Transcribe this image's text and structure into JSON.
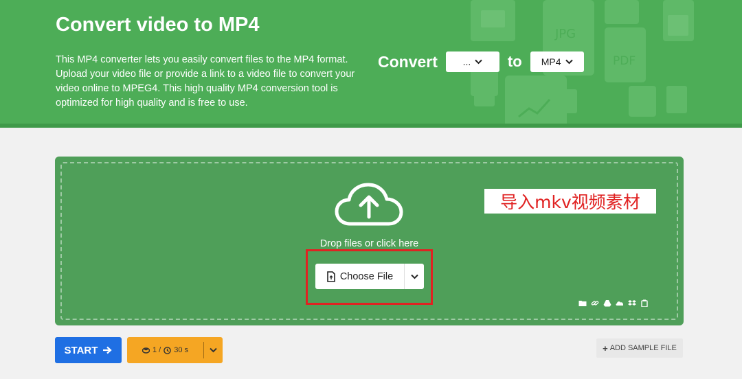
{
  "header": {
    "title": "Convert video to MP4",
    "description": "This MP4 converter lets you easily convert files to the MP4 format. Upload your video file or provide a link to a video file to convert your video online to MPEG4. This high quality MP4 conversion tool is optimized for high quality and is free to use.",
    "decor_labels": {
      "jpg": "JPG",
      "pdf": "PDF"
    }
  },
  "converter": {
    "convert_label": "Convert",
    "from_value": "...",
    "to_label": "to",
    "to_value": "MP4"
  },
  "dropzone": {
    "drop_text": "Drop files or click here",
    "choose_file_label": "Choose File",
    "annotation": "导入mkv视频素材",
    "source_icons": [
      "folder-icon",
      "link-icon",
      "google-drive-icon",
      "onedrive-icon",
      "dropbox-icon",
      "clipboard-icon"
    ]
  },
  "actions": {
    "start_label": "START",
    "limit_files": "1 /",
    "limit_time": "30 s",
    "add_sample_label": "ADD SAMPLE FILE",
    "add_sample_prefix": "+"
  },
  "colors": {
    "header_green": "#4dad57",
    "zone_green": "#4f9f59",
    "start_blue": "#1f6fe3",
    "limits_orange": "#f5a623",
    "annotation_red": "#e02222"
  }
}
